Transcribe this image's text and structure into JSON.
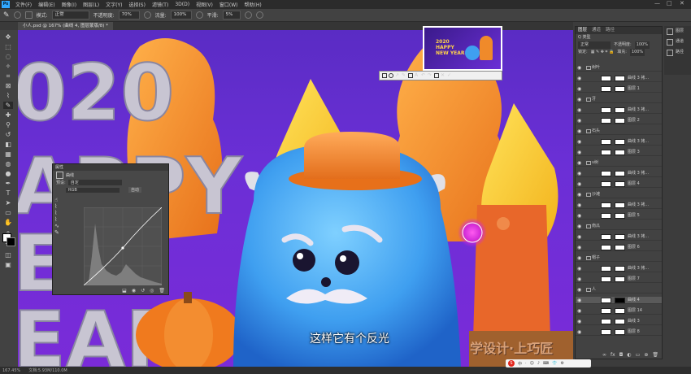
{
  "menubar": {
    "logo": "Ps",
    "items": [
      "文件(F)",
      "编辑(E)",
      "图像(I)",
      "图层(L)",
      "文字(Y)",
      "选择(S)",
      "滤镜(T)",
      "3D(D)",
      "视图(V)",
      "窗口(W)",
      "帮助(H)"
    ]
  },
  "options": {
    "mode_label": "模式:",
    "mode_value": "正常",
    "opacity_label": "不透明度:",
    "opacity_value": "70%",
    "flow_label": "流量:",
    "flow_value": "100%",
    "smooth_label": "平滑:",
    "smooth_value": "5%"
  },
  "document": {
    "tab_title": "小人.psd @ 167% (曲线 4, 图层蒙版/8) *"
  },
  "status": {
    "zoom": "167.45%",
    "doc": "文档:5.93M/110.0M"
  },
  "layers_panel": {
    "tabs": [
      "图层",
      "通道",
      "路径"
    ],
    "kind_label": "Q 类型",
    "blend_mode": "正常",
    "opacity_label": "不透明度:",
    "opacity_value": "100%",
    "lock_label": "锁定:",
    "fill_label": "填充:",
    "fill_value": "100%",
    "rows": [
      {
        "name": "树叶",
        "group": true
      },
      {
        "name": "曲线 3 拷...",
        "group": false
      },
      {
        "name": "图层 1",
        "group": false
      },
      {
        "name": "牙",
        "group": true
      },
      {
        "name": "曲线 3 拷...",
        "group": false
      },
      {
        "name": "图层 2",
        "group": false
      },
      {
        "name": "石头",
        "group": true
      },
      {
        "name": "曲线 3 拷...",
        "group": false
      },
      {
        "name": "图层 3",
        "group": false
      },
      {
        "name": "v树",
        "group": true
      },
      {
        "name": "曲线 3 拷...",
        "group": false
      },
      {
        "name": "图层 4",
        "group": false
      },
      {
        "name": "沙滩",
        "group": true
      },
      {
        "name": "曲线 3 拷...",
        "group": false
      },
      {
        "name": "图层 5",
        "group": false
      },
      {
        "name": "南瓜",
        "group": true
      },
      {
        "name": "曲线 3 拷...",
        "group": false
      },
      {
        "name": "图层 6",
        "group": false
      },
      {
        "name": "帽子",
        "group": true
      },
      {
        "name": "曲线 3 拷...",
        "group": false
      },
      {
        "name": "图层 7",
        "group": false
      },
      {
        "name": "人",
        "group": true
      },
      {
        "name": "曲线 4",
        "group": false
      },
      {
        "name": "图层 14",
        "group": false
      },
      {
        "name": "曲线 3",
        "group": false
      },
      {
        "name": "图层 8",
        "group": false
      }
    ]
  },
  "dock": {
    "items": [
      "图层",
      "通道",
      "路径"
    ]
  },
  "properties": {
    "title": "属性",
    "subtitle": "曲线",
    "preset_label": "预设:",
    "preset_value": "自定",
    "channel_value": "RGB",
    "auto_label": "自动"
  },
  "canvas": {
    "big_text_lines": [
      "020",
      "APPY",
      "EW",
      "EAR"
    ],
    "subtitle": "这样它有个反光",
    "watermark": "学设计·上巧匠",
    "thumb_text": "2020 HAPPY NEW YEAR"
  },
  "taskbar": {
    "items": [
      "中",
      "·",
      "☺",
      "♪",
      "⌨",
      "👕",
      "⚙"
    ]
  }
}
